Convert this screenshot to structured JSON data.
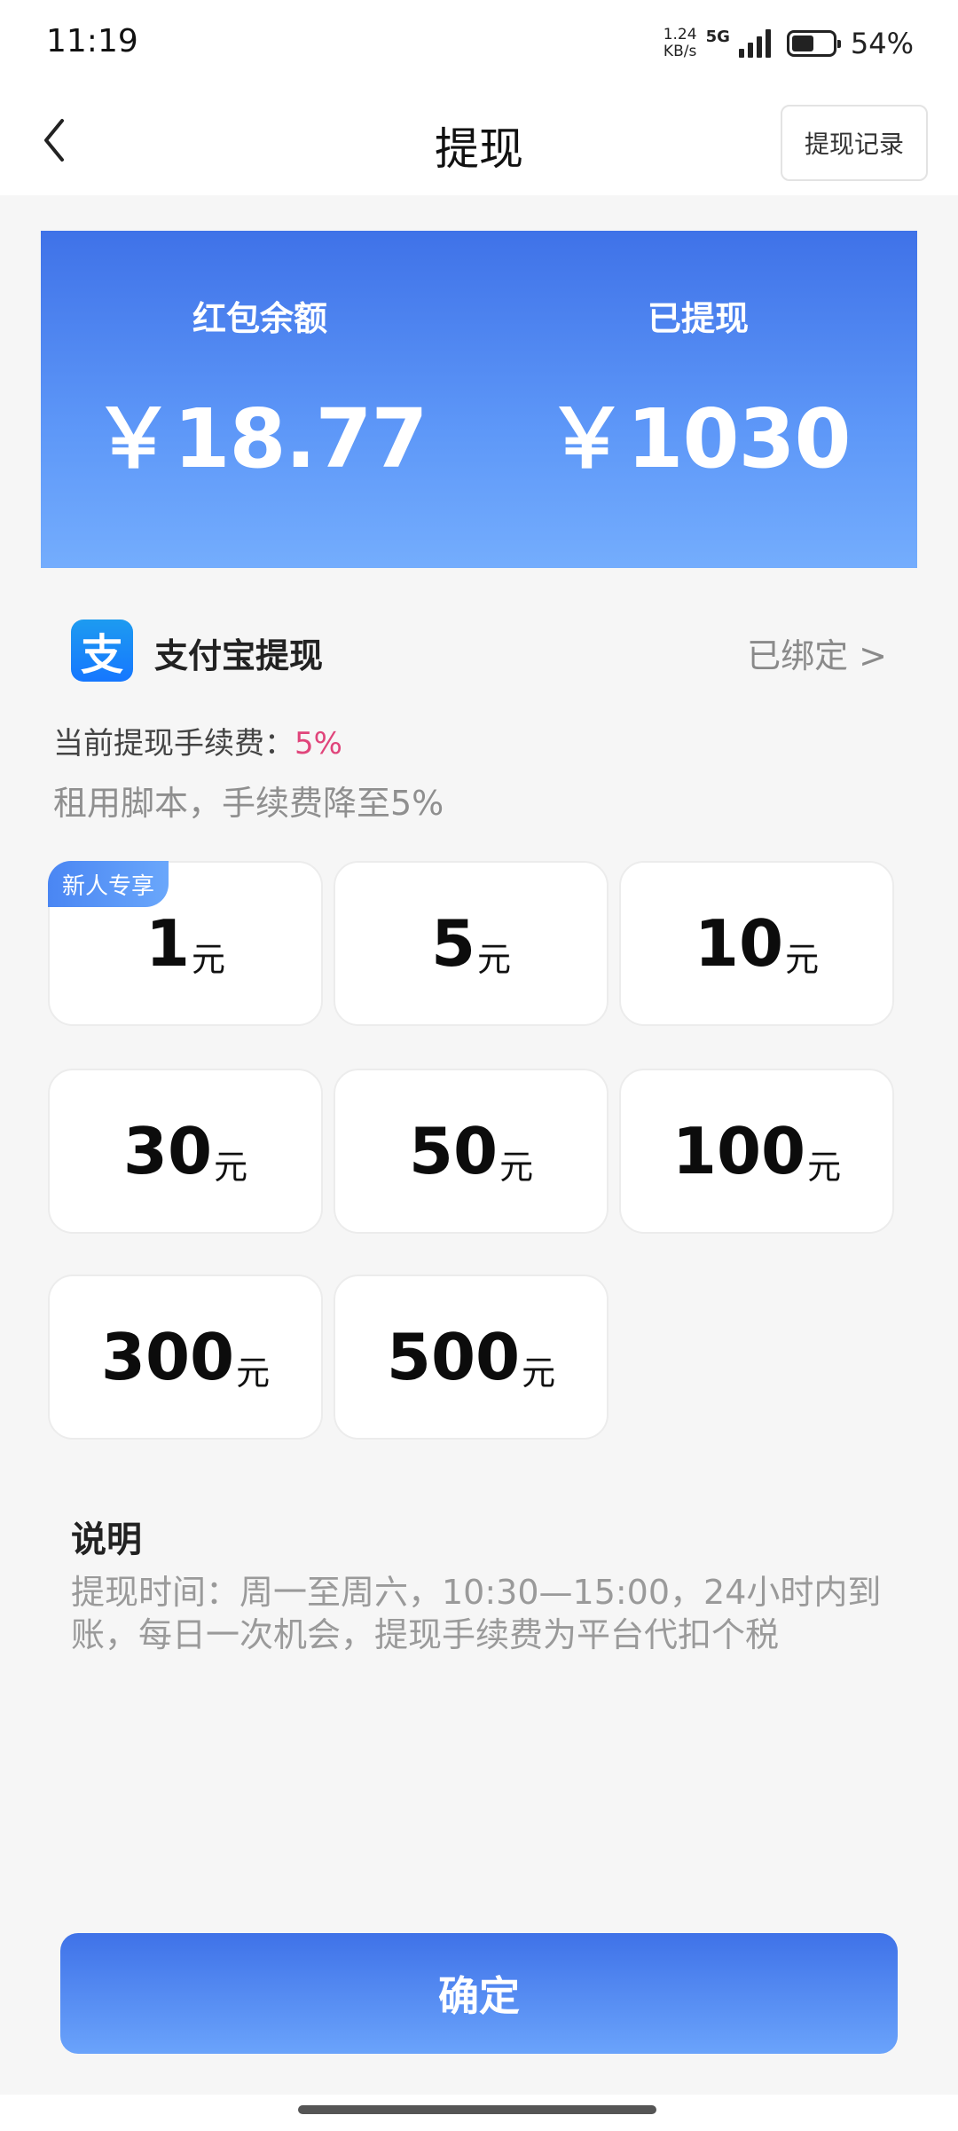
{
  "status_bar": {
    "time": "11:19",
    "net_speed": "1.24",
    "net_unit": "KB/s",
    "network": "5G",
    "battery_percent": "54%",
    "battery_level": 0.54
  },
  "header": {
    "title": "提现",
    "record_label": "提现记录"
  },
  "balance": {
    "red_packet_label": "红包余额",
    "red_packet_value": "￥18.77",
    "withdrawn_label": "已提现",
    "withdrawn_value": "￥1030"
  },
  "alipay": {
    "icon_glyph": "支",
    "label": "支付宝提现",
    "bound_status": "已绑定 >"
  },
  "fee": {
    "label": "当前提现手续费：",
    "value": "5%",
    "tip": "租用脚本，手续费降至5%"
  },
  "amounts": {
    "unit": "元",
    "new_badge": "新人专享",
    "items": [
      "1",
      "5",
      "10",
      "30",
      "50",
      "100",
      "300",
      "500"
    ]
  },
  "explanation": {
    "title": "说明",
    "body": "提现时间：周一至周六，10:30—15:00，24小时内到账，每日一次机会，提现手续费为平台代扣个税"
  },
  "confirm_label": "确定",
  "colors": {
    "accent": "#3f72e8",
    "fee_highlight": "#e0457b"
  }
}
